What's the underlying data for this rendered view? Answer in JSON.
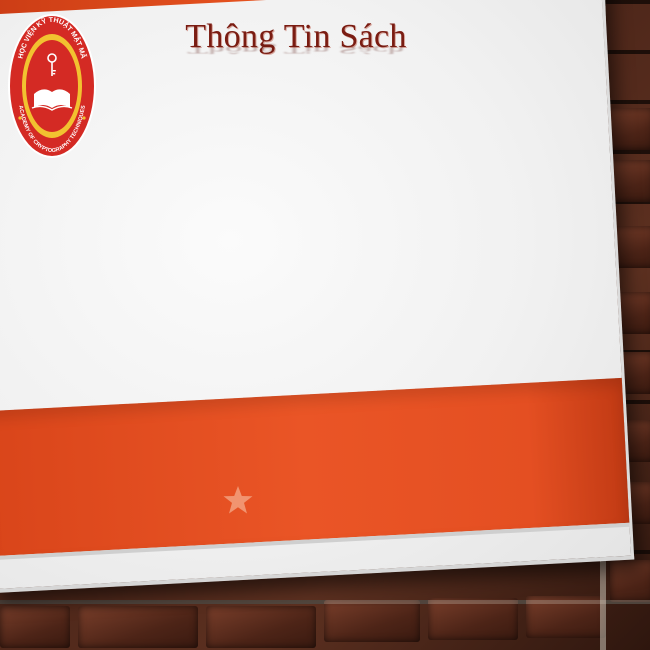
{
  "slide": {
    "title": "Thông Tin Sách"
  },
  "logo": {
    "top_text": "HỌC VIỆN KỸ THUẬT MẬT MÃ",
    "bottom_text": "ACADEMY OF CRYPTOGRAPHY TECHNIQUES",
    "icon": "open-book-key-emblem"
  },
  "decor": {
    "star_icon": "star-icon"
  },
  "colors": {
    "accent_orange": "#E5521F",
    "title_red": "#7A1C12",
    "logo_red": "#D42A24",
    "logo_gold": "#F2C230"
  }
}
